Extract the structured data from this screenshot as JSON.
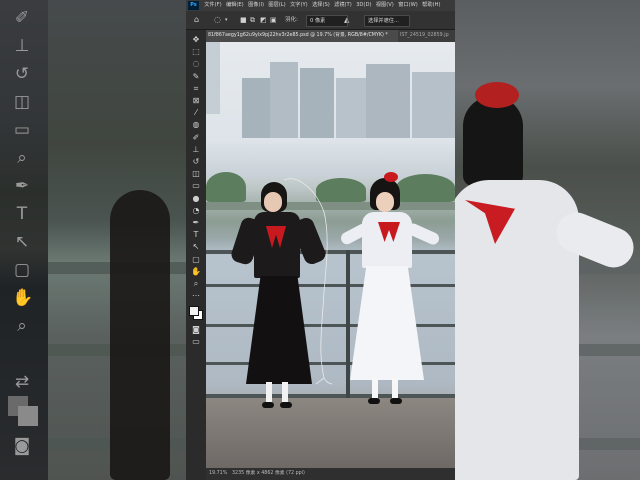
{
  "app": {
    "logo_text": "Ps",
    "menu": [
      "文件(F)",
      "编辑(E)",
      "图像(I)",
      "图层(L)",
      "文字(Y)",
      "选择(S)",
      "滤镜(T)",
      "3D(D)",
      "视图(V)",
      "窗口(W)",
      "帮助(H)"
    ]
  },
  "options_bar": {
    "feather_label": "羽化:",
    "feather_value": "0 像素",
    "select_subject_label": "选择并遮住..."
  },
  "document": {
    "active_tab_title": "81f867aegy1g62u9ylx9pj22hv3r2e85.psd @ 19.7% (背景, RGB/8#/CMYK) *",
    "second_tab_title": "IST_24519_02859.jp",
    "status_zoom": "19.71%",
    "status_size": "3235 像素 x 4862 像素 (72 ppi)"
  },
  "tools": [
    {
      "name": "move-tool-icon",
      "glyph": "✥"
    },
    {
      "name": "marquee-tool-icon",
      "glyph": "⬚"
    },
    {
      "name": "lasso-tool-icon",
      "glyph": "◌"
    },
    {
      "name": "quick-select-tool-icon",
      "glyph": "✎"
    },
    {
      "name": "crop-tool-icon",
      "glyph": "⌗"
    },
    {
      "name": "frame-tool-icon",
      "glyph": "⊠"
    },
    {
      "name": "eyedropper-tool-icon",
      "glyph": "⁄"
    },
    {
      "name": "healing-tool-icon",
      "glyph": "◍"
    },
    {
      "name": "brush-tool-icon",
      "glyph": "✐"
    },
    {
      "name": "stamp-tool-icon",
      "glyph": "⊥"
    },
    {
      "name": "history-brush-icon",
      "glyph": "↺"
    },
    {
      "name": "eraser-tool-icon",
      "glyph": "◫"
    },
    {
      "name": "gradient-tool-icon",
      "glyph": "▭"
    },
    {
      "name": "blur-tool-icon",
      "glyph": "●"
    },
    {
      "name": "dodge-tool-icon",
      "glyph": "◔"
    },
    {
      "name": "pen-tool-icon",
      "glyph": "✒"
    },
    {
      "name": "type-tool-icon",
      "glyph": "T"
    },
    {
      "name": "path-select-tool-icon",
      "glyph": "↖"
    },
    {
      "name": "shape-tool-icon",
      "glyph": "▢"
    },
    {
      "name": "hand-tool-icon",
      "glyph": "✋"
    },
    {
      "name": "zoom-tool-icon",
      "glyph": "⌕"
    },
    {
      "name": "more-tools-icon",
      "glyph": "⋯"
    }
  ],
  "colors": {
    "ps_blue": "#31a8ff",
    "ps_logo_bg": "#001e36",
    "ui_dark": "#262626",
    "dress_red": "#c8191e"
  }
}
